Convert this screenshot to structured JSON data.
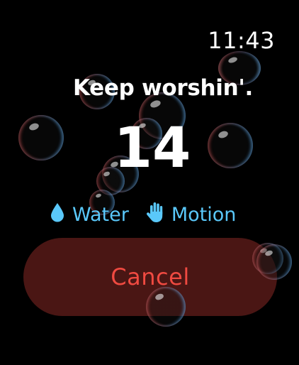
{
  "status_bar": {
    "time": "11:43"
  },
  "session": {
    "title": "Keep worshin'.",
    "count": "14"
  },
  "modes": [
    {
      "label": "Water",
      "icon": "water-drop-icon",
      "color": "#5ac8fa"
    },
    {
      "label": "Motion",
      "icon": "hand-icon",
      "color": "#5ac8fa"
    }
  ],
  "cancel_button": {
    "label": "Cancel",
    "background": "#4a1614",
    "text_color": "#f04a41"
  }
}
